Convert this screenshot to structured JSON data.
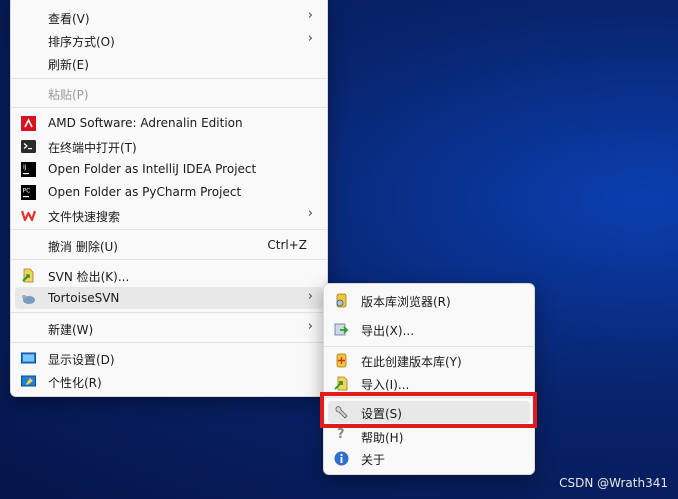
{
  "context_menu": {
    "items": {
      "view": "查看(V)",
      "sort": "排序方式(O)",
      "refresh": "刷新(E)",
      "paste": "粘贴(P)",
      "amd": "AMD Software: Adrenalin Edition",
      "terminal": "在终端中打开(T)",
      "intellij": "Open Folder as IntelliJ IDEA Project",
      "pycharm": "Open Folder as PyCharm Project",
      "wps_search": "文件快速搜索",
      "undo": "撤消 删除(U)",
      "undo_shortcut": "Ctrl+Z",
      "svn_checkout": "SVN 检出(K)...",
      "tortoisesvn": "TortoiseSVN",
      "new": "新建(W)",
      "display": "显示设置(D)",
      "personalize": "个性化(R)"
    }
  },
  "svn_submenu": {
    "items": {
      "repo_browser": "版本库浏览器(R)",
      "export": "导出(X)...",
      "create_repo": "在此创建版本库(Y)",
      "import": "导入(I)...",
      "settings": "设置(S)",
      "help": "帮助(H)",
      "about": "关于"
    }
  },
  "watermark": "CSDN @Wrath341",
  "colors": {
    "highlight_box": "#e21b1b",
    "desktop": "#08246d"
  }
}
